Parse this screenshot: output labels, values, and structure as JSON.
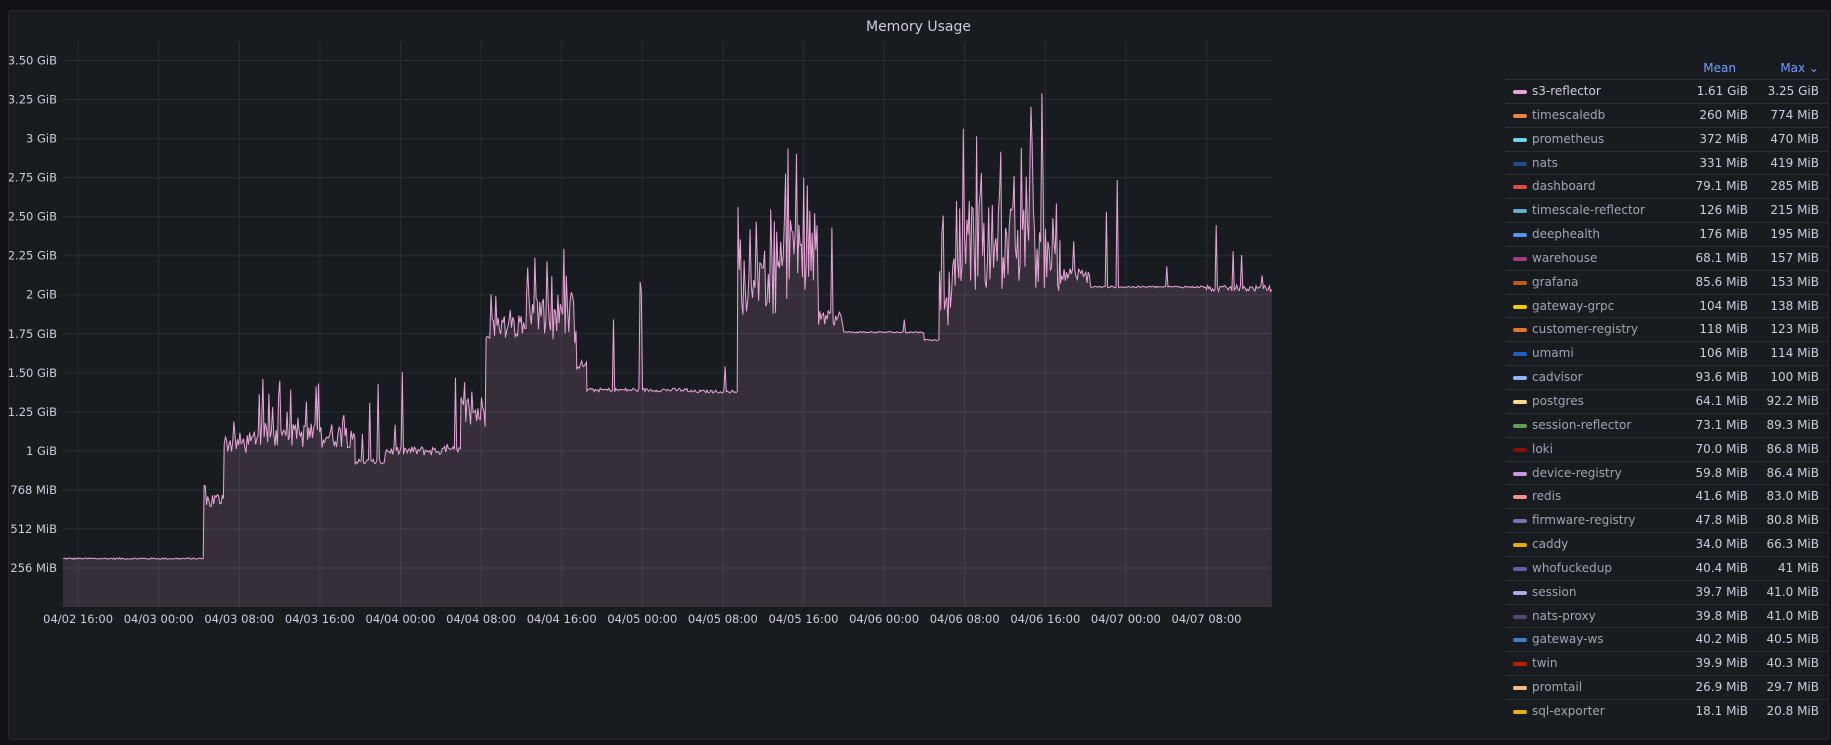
{
  "panel": {
    "title": "Memory Usage"
  },
  "legend": {
    "mean_header": "Mean",
    "max_header": "Max ⌄",
    "rows": [
      {
        "name": "s3-reflector",
        "color": "#e7a6d8",
        "mean": "1.61 GiB",
        "max": "3.25 GiB"
      },
      {
        "name": "timescaledb",
        "color": "#ef843c",
        "mean": "260 MiB",
        "max": "774 MiB"
      },
      {
        "name": "prometheus",
        "color": "#6ed0e0",
        "mean": "372 MiB",
        "max": "470 MiB"
      },
      {
        "name": "nats",
        "color": "#1f4e8c",
        "mean": "331 MiB",
        "max": "419 MiB"
      },
      {
        "name": "dashboard",
        "color": "#e24d42",
        "mean": "79.1 MiB",
        "max": "285 MiB"
      },
      {
        "name": "timescale-reflector",
        "color": "#64b0c8",
        "mean": "126 MiB",
        "max": "215 MiB"
      },
      {
        "name": "deephealth",
        "color": "#5794f2",
        "mean": "176 MiB",
        "max": "195 MiB"
      },
      {
        "name": "warehouse",
        "color": "#a23c87",
        "mean": "68.1 MiB",
        "max": "157 MiB"
      },
      {
        "name": "grafana",
        "color": "#c15c17",
        "mean": "85.6 MiB",
        "max": "153 MiB"
      },
      {
        "name": "gateway-grpc",
        "color": "#f2cc0c",
        "mean": "104 MiB",
        "max": "138 MiB"
      },
      {
        "name": "customer-registry",
        "color": "#e0752d",
        "mean": "118 MiB",
        "max": "123 MiB"
      },
      {
        "name": "umami",
        "color": "#1f60c4",
        "mean": "106 MiB",
        "max": "114 MiB"
      },
      {
        "name": "cadvisor",
        "color": "#8ab8ff",
        "mean": "93.6 MiB",
        "max": "100 MiB"
      },
      {
        "name": "postgres",
        "color": "#ffdb89",
        "mean": "64.1 MiB",
        "max": "92.2 MiB"
      },
      {
        "name": "session-reflector",
        "color": "#629e51",
        "mean": "73.1 MiB",
        "max": "89.3 MiB"
      },
      {
        "name": "loki",
        "color": "#890f02",
        "mean": "70.0 MiB",
        "max": "86.8 MiB"
      },
      {
        "name": "device-registry",
        "color": "#ca95e5",
        "mean": "59.8 MiB",
        "max": "86.4 MiB"
      },
      {
        "name": "redis",
        "color": "#f29191",
        "mean": "41.6 MiB",
        "max": "83.0 MiB"
      },
      {
        "name": "firmware-registry",
        "color": "#806eb7",
        "mean": "47.8 MiB",
        "max": "80.8 MiB"
      },
      {
        "name": "caddy",
        "color": "#e5ac0e",
        "mean": "34.0 MiB",
        "max": "66.3 MiB"
      },
      {
        "name": "whofuckedup",
        "color": "#6d5ca8",
        "mean": "40.4 MiB",
        "max": "41 MiB"
      },
      {
        "name": "session",
        "color": "#b0a6e0",
        "mean": "39.7 MiB",
        "max": "41.0 MiB"
      },
      {
        "name": "nats-proxy",
        "color": "#584477",
        "mean": "39.8 MiB",
        "max": "41.0 MiB"
      },
      {
        "name": "gateway-ws",
        "color": "#447ebc",
        "mean": "40.2 MiB",
        "max": "40.5 MiB"
      },
      {
        "name": "twin",
        "color": "#bf1b00",
        "mean": "39.9 MiB",
        "max": "40.3 MiB"
      },
      {
        "name": "promtail",
        "color": "#f9ba8f",
        "mean": "26.9 MiB",
        "max": "29.7 MiB"
      },
      {
        "name": "sql-exporter",
        "color": "#e0b400",
        "mean": "18.1 MiB",
        "max": "20.8 MiB"
      }
    ]
  },
  "chart_data": {
    "type": "area",
    "title": "Memory Usage",
    "ylim": [
      0,
      3.625
    ],
    "y_tick_values": [
      0.25,
      0.5,
      0.75,
      1,
      1.25,
      1.5,
      1.75,
      2,
      2.25,
      2.5,
      2.75,
      3,
      3.25,
      3.5
    ],
    "y_tick_labels": [
      "256 MiB",
      "512 MiB",
      "768 MiB",
      "1 GiB",
      "1.25 GiB",
      "1.50 GiB",
      "1.75 GiB",
      "2 GiB",
      "2.25 GiB",
      "2.50 GiB",
      "2.75 GiB",
      "3 GiB",
      "3.25 GiB",
      "3.50 GiB"
    ],
    "x_tick_labels": [
      "04/02 16:00",
      "04/03 00:00",
      "04/03 08:00",
      "04/03 16:00",
      "04/04 00:00",
      "04/04 08:00",
      "04/04 16:00",
      "04/05 00:00",
      "04/05 08:00",
      "04/05 16:00",
      "04/06 00:00",
      "04/06 08:00",
      "04/06 16:00",
      "04/07 00:00",
      "04/07 08:00"
    ],
    "x_hours_per_tick": 8,
    "x_start_hours": -1.5,
    "x_end_hours": 118.5,
    "grid": true,
    "legend_position": "right",
    "series": [
      {
        "name": "s3-reflector",
        "color": "#e7a6d8",
        "segments": [
          {
            "x0": -1.5,
            "x1": 12.5,
            "base": 0.31,
            "noise": 0.005,
            "spike_prob": 0,
            "spike_max": 0
          },
          {
            "x0": 12.5,
            "x1": 14.5,
            "base": 0.68,
            "noise": 0.06,
            "spike_prob": 0.1,
            "spike_max": 0.1
          },
          {
            "x0": 14.5,
            "x1": 17.5,
            "base": 1.05,
            "noise": 0.07,
            "spike_prob": 0.1,
            "spike_max": 0.15
          },
          {
            "x0": 17.5,
            "x1": 27.5,
            "base": 1.1,
            "noise": 0.08,
            "spike_prob": 0.15,
            "spike_max": 0.4
          },
          {
            "x0": 27.5,
            "x1": 30.5,
            "base": 0.93,
            "noise": 0.02,
            "spike_prob": 0.12,
            "spike_max": 0.55
          },
          {
            "x0": 30.5,
            "x1": 38,
            "base": 1.0,
            "noise": 0.03,
            "spike_prob": 0.08,
            "spike_max": 0.5
          },
          {
            "x0": 38,
            "x1": 40.5,
            "base": 1.25,
            "noise": 0.12,
            "spike_prob": 0.08,
            "spike_max": 0.35
          },
          {
            "x0": 40.5,
            "x1": 44.5,
            "base": 1.8,
            "noise": 0.08,
            "spike_prob": 0.15,
            "spike_max": 0.3
          },
          {
            "x0": 44.5,
            "x1": 49.5,
            "base": 1.85,
            "noise": 0.18,
            "spike_prob": 0.2,
            "spike_max": 0.5
          },
          {
            "x0": 49.5,
            "x1": 50.5,
            "base": 1.55,
            "noise": 0.03,
            "spike_prob": 0.05,
            "spike_max": 0.2
          },
          {
            "x0": 50.5,
            "x1": 60.5,
            "base": 1.39,
            "noise": 0.012,
            "spike_prob": 0.03,
            "spike_max": 0.75
          },
          {
            "x0": 60.5,
            "x1": 65.5,
            "base": 1.38,
            "noise": 0.01,
            "spike_prob": 0.04,
            "spike_max": 0.65
          },
          {
            "x0": 65.5,
            "x1": 69.5,
            "base": 2.05,
            "noise": 0.18,
            "spike_prob": 0.2,
            "spike_max": 0.5
          },
          {
            "x0": 69.5,
            "x1": 73.5,
            "base": 2.2,
            "noise": 0.25,
            "spike_prob": 0.25,
            "spike_max": 0.6
          },
          {
            "x0": 73.5,
            "x1": 76,
            "base": 1.85,
            "noise": 0.05,
            "spike_prob": 0.05,
            "spike_max": 0.8
          },
          {
            "x0": 76,
            "x1": 84,
            "base": 1.76,
            "noise": 0.005,
            "spike_prob": 0.01,
            "spike_max": 0.1
          },
          {
            "x0": 84,
            "x1": 85.5,
            "base": 1.71,
            "noise": 0.005,
            "spike_prob": 0,
            "spike_max": 0
          },
          {
            "x0": 85.5,
            "x1": 87.5,
            "base": 2.0,
            "noise": 0.2,
            "spike_prob": 0.25,
            "spike_max": 0.6
          },
          {
            "x0": 87.5,
            "x1": 97.5,
            "base": 2.3,
            "noise": 0.28,
            "spike_prob": 0.25,
            "spike_max": 0.8
          },
          {
            "x0": 97.5,
            "x1": 100.5,
            "base": 2.12,
            "noise": 0.05,
            "spike_prob": 0.1,
            "spike_max": 0.5
          },
          {
            "x0": 100.5,
            "x1": 112,
            "base": 2.05,
            "noise": 0.006,
            "spike_prob": 0.02,
            "spike_max": 0.95
          },
          {
            "x0": 112,
            "x1": 118.5,
            "base": 2.04,
            "noise": 0.02,
            "spike_prob": 0.08,
            "spike_max": 0.45
          }
        ]
      }
    ]
  }
}
